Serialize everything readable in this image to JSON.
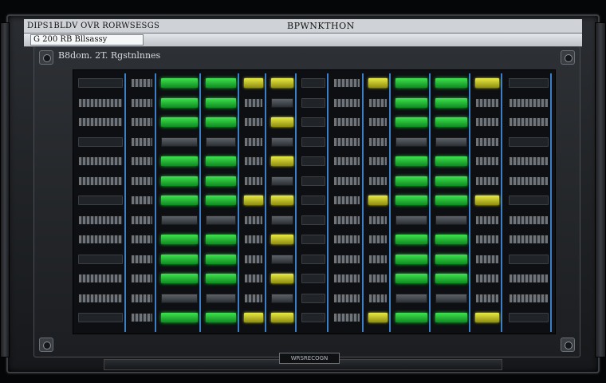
{
  "titlebar": {
    "left_text": "DIPS1BLDV OVR RORWSESGS",
    "center_text": "BPWNKTHON"
  },
  "address": {
    "value": "G 200 RB Bllsassy"
  },
  "panel": {
    "header": "B8dom.  2T. Rgstnlnnes"
  },
  "bottom": {
    "label": "WRSRECOGN"
  },
  "colors": {
    "accent": "#3c7fc7",
    "led_green": "#3fe24f",
    "led_yellow": "#e8ea43"
  }
}
